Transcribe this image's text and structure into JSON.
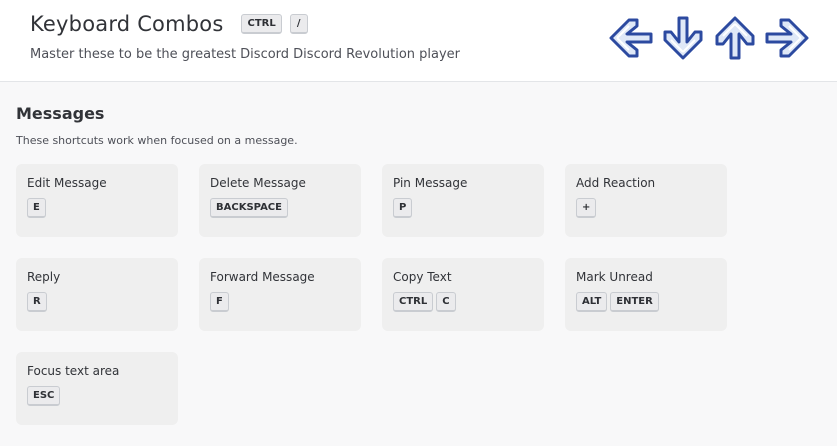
{
  "header": {
    "title": "Keyboard Combos",
    "title_keys": [
      "CTRL",
      "/"
    ],
    "subtitle": "Master these to be the greatest Discord Discord Revolution player",
    "arrow_icons": [
      "arrow-left-icon",
      "arrow-down-icon",
      "arrow-up-icon",
      "arrow-right-icon"
    ]
  },
  "section": {
    "title": "Messages",
    "description": "These shortcuts work when focused on a message."
  },
  "shortcuts": [
    {
      "label": "Edit Message",
      "keys": [
        "E"
      ]
    },
    {
      "label": "Delete Message",
      "keys": [
        "BACKSPACE"
      ]
    },
    {
      "label": "Pin Message",
      "keys": [
        "P"
      ]
    },
    {
      "label": "Add Reaction",
      "keys": [
        "+"
      ]
    },
    {
      "label": "Reply",
      "keys": [
        "R"
      ]
    },
    {
      "label": "Forward Message",
      "keys": [
        "F"
      ]
    },
    {
      "label": "Copy Text",
      "keys": [
        "CTRL",
        "C"
      ]
    },
    {
      "label": "Mark Unread",
      "keys": [
        "ALT",
        "ENTER"
      ]
    },
    {
      "label": "Focus text area",
      "keys": [
        "ESC"
      ]
    }
  ],
  "colors": {
    "arrow_fill": "#dfe8f7",
    "arrow_stroke": "#2c4aa0",
    "card_bg": "#efefef",
    "page_bg": "#f8f8f9"
  }
}
